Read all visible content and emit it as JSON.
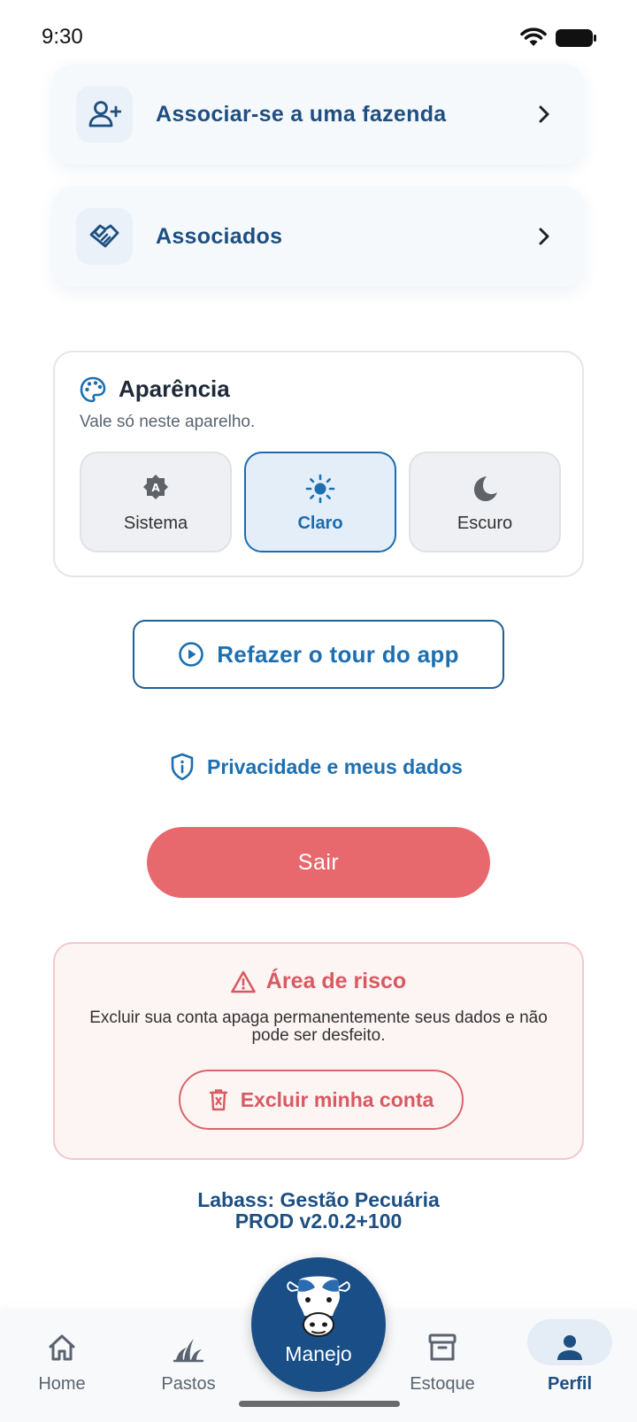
{
  "status_bar": {
    "time": "9:30"
  },
  "menu": {
    "associate_farm": "Associar-se a uma fazenda",
    "associates": "Associados"
  },
  "appearance": {
    "title": "Aparência",
    "subtitle": "Vale só neste aparelho.",
    "options": [
      {
        "label": "Sistema",
        "icon": "auto-mode-icon",
        "selected": false
      },
      {
        "label": "Claro",
        "icon": "sun-icon",
        "selected": true
      },
      {
        "label": "Escuro",
        "icon": "moon-icon",
        "selected": false
      }
    ]
  },
  "tour_button": "Refazer o tour do app",
  "privacy_link": "Privacidade e meus dados",
  "logout_button": "Sair",
  "risk_area": {
    "title": "Área de risco",
    "text": "Excluir sua conta apaga permanentemente seus dados e não pode ser desfeito.",
    "delete_button": "Excluir minha conta"
  },
  "app_info": {
    "name": "Labass: Gestão Pecuária",
    "version": "PROD v2.0.2+100"
  },
  "bottom_nav": {
    "items": [
      {
        "label": "Home",
        "icon": "home-icon"
      },
      {
        "label": "Pastos",
        "icon": "grass-icon"
      },
      {
        "label": "Manejo",
        "icon": "cow-icon"
      },
      {
        "label": "Estoque",
        "icon": "archive-box-icon"
      },
      {
        "label": "Perfil",
        "icon": "person-icon",
        "active": true
      }
    ]
  },
  "colors": {
    "primary": "#1d4f82",
    "accent": "#1d6fb0",
    "danger": "#e7696e",
    "danger_text": "#d85a61"
  }
}
